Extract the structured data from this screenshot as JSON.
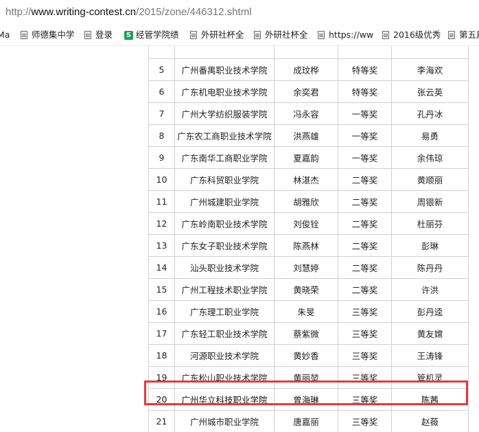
{
  "url": {
    "scheme": "http://",
    "host": "www.writing-contest.cn",
    "path": "/2015/zone/446312.shtml"
  },
  "bookmarks": [
    {
      "label": "Ma",
      "icon": "none"
    },
    {
      "label": "师德集中学",
      "icon": "document-icon"
    },
    {
      "label": "登录",
      "icon": "document-icon"
    },
    {
      "label": "经管学院绩",
      "icon": "sheets-icon",
      "icon_glyph": "S",
      "icon_color": "#1f9d55"
    },
    {
      "label": "外研社杯全",
      "icon": "document-icon"
    },
    {
      "label": "外研社杯全",
      "icon": "document-icon"
    },
    {
      "label": "https://ww",
      "icon": "document-icon"
    },
    {
      "label": "2016级优秀",
      "icon": "document-icon"
    },
    {
      "label": "第五届",
      "icon": "document-icon"
    }
  ],
  "table": {
    "rows": [
      [
        "",
        "",
        "",
        "",
        ""
      ],
      [
        "5",
        "广州番禺职业技术学院",
        "成玟桦",
        "特等奖",
        "李海欢"
      ],
      [
        "6",
        "广东机电职业技术学院",
        "余奕君",
        "特等奖",
        "张云英"
      ],
      [
        "7",
        "广州大学纺织服装学院",
        "冯永容",
        "一等奖",
        "孔丹冰"
      ],
      [
        "8",
        "广东农工商职业技术学院",
        "洪燕雄",
        "一等奖",
        "易勇"
      ],
      [
        "9",
        "广东南华工商职业学院",
        "夏嘉韵",
        "一等奖",
        "余伟琼"
      ],
      [
        "10",
        "广东科贸职业学院",
        "林湛杰",
        "二等奖",
        "黄顺丽"
      ],
      [
        "11",
        "广州城建职业学院",
        "胡雅欣",
        "二等奖",
        "周银新"
      ],
      [
        "12",
        "广东岭南职业技术学院",
        "刘俊铨",
        "二等奖",
        "杜丽芬"
      ],
      [
        "13",
        "广东女子职业技术学院",
        "陈燕林",
        "二等奖",
        "彭琳"
      ],
      [
        "14",
        "汕头职业技术学院",
        "刘慧婷",
        "二等奖",
        "陈丹丹"
      ],
      [
        "15",
        "广州工程技术职业学院",
        "黄晓荣",
        "二等奖",
        "许洪"
      ],
      [
        "16",
        "广东理工职业学院",
        "朱旻",
        "三等奖",
        "彭丹逵"
      ],
      [
        "17",
        "广东轻工职业技术学院",
        "蔡紫微",
        "三等奖",
        "黄友嫦"
      ],
      [
        "18",
        "河源职业技术学院",
        "黄妙香",
        "三等奖",
        "王涛锋"
      ],
      [
        "19",
        "广东松山职业技术学院",
        "黄丽堃",
        "三等奖",
        "管机灵"
      ],
      [
        "20",
        "广州华立科技职业学院",
        "曾海琳",
        "三等奖",
        "陈茜"
      ],
      [
        "21",
        "广州城市职业学院",
        "唐嘉丽",
        "三等奖",
        "赵薇"
      ]
    ],
    "highlighted_rank": "20",
    "highlight_color": "#e8383d"
  }
}
